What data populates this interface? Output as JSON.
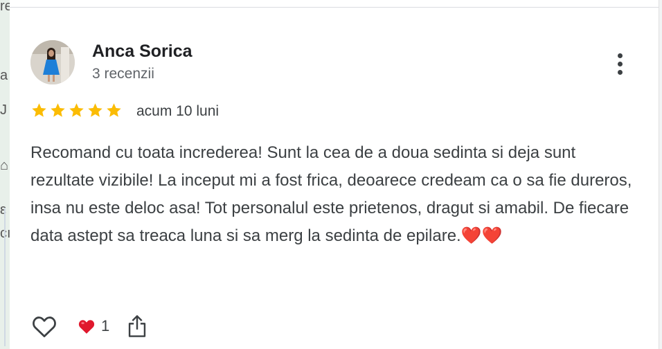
{
  "review": {
    "reviewer_name": "Anca Sorica",
    "review_count": "3 recenzii",
    "rating": 5,
    "max_rating": 5,
    "time": "acum 10 luni",
    "text": "Recomand cu toata increderea! Sunt la cea de a doua sedinta si deja sunt rezultate vizibile! La inceput mi a fost frica, deoarece credeam ca o sa fie dureros, insa nu este deloc asa! Tot personalul este prietenos, dragut si amabil. De fiecare data astept sa treaca luna si sa merg la sedinta de epilare.❤️❤️",
    "reaction_count": "1"
  },
  "icons": {
    "menu": "more-vert-icon",
    "star": "star-icon",
    "like": "heart-outline-icon",
    "reaction": "red-heart-icon",
    "share": "share-icon"
  },
  "colors": {
    "star": "#fbbc04",
    "text": "#3c4043",
    "name": "#202124",
    "muted": "#5f6368",
    "reaction": "#e0182d"
  },
  "map_strip": {
    "glyphs": [
      "re",
      "a",
      "J",
      "⌂",
      "ε",
      "cı"
    ]
  }
}
